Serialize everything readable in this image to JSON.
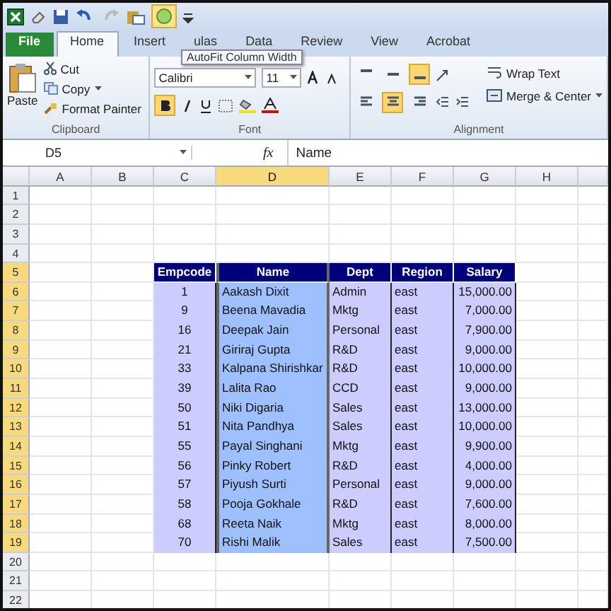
{
  "quick_access": {
    "tooltip": "AutoFit Column Width",
    "autofit_selected": true
  },
  "tabs": [
    {
      "label": "File",
      "kind": "file",
      "selected": false
    },
    {
      "label": "Home",
      "kind": "tab",
      "selected": true
    },
    {
      "label": "Insert",
      "kind": "tab",
      "selected": false
    },
    {
      "label": "ulas",
      "kind": "tab",
      "selected": false
    },
    {
      "label": "Data",
      "kind": "tab",
      "selected": false
    },
    {
      "label": "Review",
      "kind": "tab",
      "selected": false
    },
    {
      "label": "View",
      "kind": "tab",
      "selected": false
    },
    {
      "label": "Acrobat",
      "kind": "tab",
      "selected": false
    }
  ],
  "ribbon": {
    "clipboard": {
      "paste": "Paste",
      "cut": "Cut",
      "copy": "Copy",
      "format_painter": "Format Painter",
      "label": "Clipboard"
    },
    "font": {
      "name": "Calibri",
      "size": "11",
      "bold": true,
      "label": "Font"
    },
    "alignment": {
      "vertical": [
        {
          "selected": false
        },
        {
          "selected": false
        },
        {
          "selected": true
        }
      ],
      "horizontal": [
        {
          "selected": false
        },
        {
          "selected": true
        },
        {
          "selected": false
        }
      ],
      "wrap_text": "Wrap Text",
      "merge": "Merge & Center",
      "label": "Alignment"
    }
  },
  "formula_bar": {
    "name_box": "D5",
    "function_label": "fx",
    "value": "Name"
  },
  "sheet": {
    "columns": [
      {
        "label": "A",
        "selected": false
      },
      {
        "label": "B",
        "selected": false
      },
      {
        "label": "C",
        "selected": false
      },
      {
        "label": "D",
        "selected": true
      },
      {
        "label": "E",
        "selected": false
      },
      {
        "label": "F",
        "selected": false
      },
      {
        "label": "G",
        "selected": false
      },
      {
        "label": "H",
        "selected": false
      }
    ],
    "rows": [
      {
        "label": "1",
        "selected": false,
        "kind": "empty",
        "cells": []
      },
      {
        "label": "2",
        "selected": false,
        "kind": "empty",
        "cells": []
      },
      {
        "label": "3",
        "selected": false,
        "kind": "empty",
        "cells": []
      },
      {
        "label": "4",
        "selected": false,
        "kind": "empty",
        "cells": []
      },
      {
        "label": "5",
        "selected": true,
        "kind": "header",
        "cells": [
          "",
          "",
          "Empcode",
          "Name",
          "Dept",
          "Region",
          "Salary"
        ]
      },
      {
        "label": "6",
        "selected": true,
        "kind": "data",
        "cells": [
          "",
          "",
          "1",
          "Aakash Dixit",
          "Admin",
          "east",
          "15,000.00"
        ]
      },
      {
        "label": "7",
        "selected": true,
        "kind": "data",
        "cells": [
          "",
          "",
          "9",
          "Beena Mavadia",
          "Mktg",
          "east",
          "7,000.00"
        ]
      },
      {
        "label": "8",
        "selected": true,
        "kind": "data",
        "cells": [
          "",
          "",
          "16",
          "Deepak Jain",
          "Personal",
          "east",
          "7,900.00"
        ]
      },
      {
        "label": "9",
        "selected": true,
        "kind": "data",
        "cells": [
          "",
          "",
          "21",
          "Giriraj Gupta",
          "R&D",
          "east",
          "9,000.00"
        ]
      },
      {
        "label": "10",
        "selected": true,
        "kind": "data",
        "cells": [
          "",
          "",
          "33",
          "Kalpana Shirishkar",
          "R&D",
          "east",
          "10,000.00"
        ]
      },
      {
        "label": "11",
        "selected": true,
        "kind": "data",
        "cells": [
          "",
          "",
          "39",
          "Lalita Rao",
          "CCD",
          "east",
          "9,000.00"
        ]
      },
      {
        "label": "12",
        "selected": true,
        "kind": "data",
        "cells": [
          "",
          "",
          "50",
          "Niki Digaria",
          "Sales",
          "east",
          "13,000.00"
        ]
      },
      {
        "label": "13",
        "selected": true,
        "kind": "data",
        "cells": [
          "",
          "",
          "51",
          "Nita Pandhya",
          "Sales",
          "east",
          "10,000.00"
        ]
      },
      {
        "label": "14",
        "selected": true,
        "kind": "data",
        "cells": [
          "",
          "",
          "55",
          "Payal Singhani",
          "Mktg",
          "east",
          "9,900.00"
        ]
      },
      {
        "label": "15",
        "selected": true,
        "kind": "data",
        "cells": [
          "",
          "",
          "56",
          "Pinky Robert",
          "R&D",
          "east",
          "4,000.00"
        ]
      },
      {
        "label": "16",
        "selected": true,
        "kind": "data",
        "cells": [
          "",
          "",
          "57",
          "Piyush Surti",
          "Personal",
          "east",
          "9,000.00"
        ]
      },
      {
        "label": "17",
        "selected": true,
        "kind": "data",
        "cells": [
          "",
          "",
          "58",
          "Pooja Gokhale",
          "R&D",
          "east",
          "7,600.00"
        ]
      },
      {
        "label": "18",
        "selected": true,
        "kind": "data",
        "cells": [
          "",
          "",
          "68",
          "Reeta Naik",
          "Mktg",
          "east",
          "8,000.00"
        ]
      },
      {
        "label": "19",
        "selected": true,
        "kind": "data",
        "cells": [
          "",
          "",
          "70",
          "Rishi Malik",
          "Sales",
          "east",
          "7,500.00"
        ]
      },
      {
        "label": "20",
        "selected": false,
        "kind": "empty",
        "cells": []
      },
      {
        "label": "21",
        "selected": false,
        "kind": "empty",
        "cells": []
      },
      {
        "label": "22",
        "selected": false,
        "kind": "empty",
        "cells": []
      }
    ]
  }
}
